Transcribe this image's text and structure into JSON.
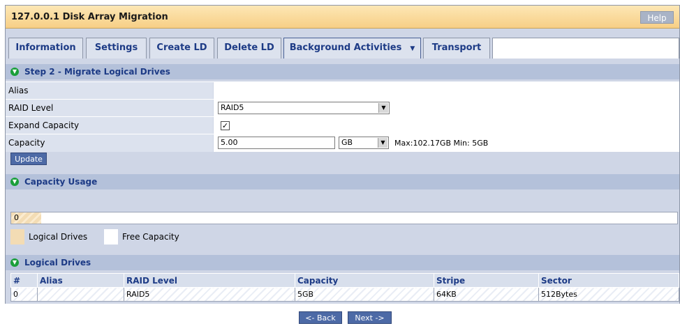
{
  "window": {
    "title": "127.0.0.1 Disk Array Migration",
    "help_label": "Help"
  },
  "tabs": [
    {
      "label": "Information"
    },
    {
      "label": "Settings"
    },
    {
      "label": "Create LD"
    },
    {
      "label": "Delete LD"
    },
    {
      "label": "Background Activities",
      "active": true,
      "has_dropdown": true
    },
    {
      "label": "Transport"
    }
  ],
  "step": {
    "title": "Step 2 - Migrate Logical Drives"
  },
  "form": {
    "alias": {
      "label": "Alias",
      "value": ""
    },
    "raid_level": {
      "label": "RAID Level",
      "value": "RAID5"
    },
    "expand_capacity": {
      "label": "Expand Capacity",
      "checked": true
    },
    "capacity": {
      "label": "Capacity",
      "value": "5.00",
      "unit": "GB",
      "limits": "Max:102.17GB Min: 5GB"
    },
    "update_label": "Update"
  },
  "capacity_usage": {
    "title": "Capacity Usage",
    "bar_label": "0",
    "used_fraction": 0.045,
    "legend": [
      {
        "label": "Logical Drives",
        "color": "#f3dcb4"
      },
      {
        "label": "Free Capacity",
        "color": "#ffffff"
      }
    ]
  },
  "logical_drives": {
    "title": "Logical Drives",
    "columns": [
      "#",
      "Alias",
      "RAID Level",
      "Capacity",
      "Stripe",
      "Sector"
    ],
    "rows": [
      [
        "0",
        "",
        "RAID5",
        "5GB",
        "64KB",
        "512Bytes"
      ]
    ]
  },
  "nav": {
    "back_label": "<- Back",
    "next_label": "Next ->"
  },
  "colors": {
    "accent": "#1d3b86",
    "status_green": "#1a9f3a",
    "title_bar": "#f7cf86",
    "button": "#4d6aa6"
  }
}
